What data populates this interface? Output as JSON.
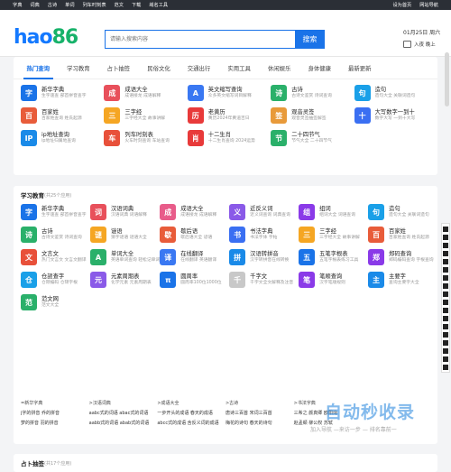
{
  "topbar": {
    "links": [
      "字典",
      "词典",
      "古诗",
      "单词",
      "列车时刻表",
      "范文",
      "下载",
      "域名工具"
    ],
    "right": [
      "设为首页",
      "网站导航"
    ]
  },
  "logo": {
    "a": "hao",
    "b": "86"
  },
  "search": {
    "placeholder": "请输入搜索内容",
    "button": "搜索"
  },
  "date": {
    "text": "01月25日 周六",
    "login": "入夜 晚上"
  },
  "tabs": [
    "热门查询",
    "学习教育",
    "占卜抽签",
    "民俗文化",
    "交通出行",
    "实用工具",
    "休闲娱乐",
    "身体健康",
    "最新更新"
  ],
  "hot": [
    {
      "t": "新华字典",
      "d": "生字速查 部首拼音查字",
      "c": "#1a73e8",
      "i": "字"
    },
    {
      "t": "成语大全",
      "d": "成语接龙 成语解释",
      "c": "#e8505b",
      "i": "成"
    },
    {
      "t": "英文缩写查询",
      "d": "众多英文缩写词目解释",
      "c": "#3a78f2",
      "i": "A"
    },
    {
      "t": "古诗",
      "d": "古诗文鉴赏 诗词查询",
      "c": "#2ab06a",
      "i": "诗"
    },
    {
      "t": "造句",
      "d": "造句大全 关联词造句",
      "c": "#1aa0e8",
      "i": "句"
    },
    {
      "t": "百家姓",
      "d": "百家姓查询 姓氏起源",
      "c": "#e85c3a",
      "i": "百"
    },
    {
      "t": "三字经",
      "d": "三字经大全 故事讲解",
      "c": "#f5a623",
      "i": "三"
    },
    {
      "t": "老黄历",
      "d": "黄历2024年黄道吉日",
      "c": "#e83a3a",
      "i": "历"
    },
    {
      "t": "观音灵签",
      "d": "观音灵签抽签解签",
      "c": "#e89a3a",
      "i": "签"
    },
    {
      "t": "大写数字一到十",
      "d": "数字大写 一到十大写",
      "c": "#3a6ff2",
      "i": "十"
    },
    {
      "t": "ip地址查询",
      "d": "ip地址归属地查询",
      "c": "#1a8ae8",
      "i": "IP"
    },
    {
      "t": "列车时刻表",
      "d": "火车时刻查询 车站查询",
      "c": "#e8503a",
      "i": "车"
    },
    {
      "t": "十二生肖",
      "d": "十二生肖查询 2024运势",
      "c": "#e83a3a",
      "i": "肖"
    },
    {
      "t": "二十四节气",
      "d": "节气大全 二十四节气",
      "c": "#2ab06a",
      "i": "节"
    }
  ],
  "study": {
    "title": "学习教育",
    "count": "(共25个应用)"
  },
  "edu": [
    {
      "t": "新华字典",
      "d": "生字速查 部首拼音查字",
      "c": "#1a73e8",
      "i": "字"
    },
    {
      "t": "汉语词典",
      "d": "汉语词典 词语解释",
      "c": "#e8505b",
      "i": "词"
    },
    {
      "t": "成语大全",
      "d": "成语接龙 成语解释",
      "c": "#e85c8a",
      "i": "成"
    },
    {
      "t": "近反义词",
      "d": "近义词查询 词典查询",
      "c": "#8a5ae8",
      "i": "义"
    },
    {
      "t": "组词",
      "d": "组词大全 词语查询",
      "c": "#8a3ae8",
      "i": "组"
    },
    {
      "t": "造句",
      "d": "造句大全 关联词造句",
      "c": "#1aa0e8",
      "i": "句"
    },
    {
      "t": "古诗",
      "d": "古诗文鉴赏 诗词查询",
      "c": "#2ab06a",
      "i": "诗"
    },
    {
      "t": "谜语",
      "d": "猜字谜语 谜语大全",
      "c": "#f5a623",
      "i": "谜"
    },
    {
      "t": "歇后语",
      "d": "歇后语大全 谚语",
      "c": "#e85c3a",
      "i": "歇"
    },
    {
      "t": "书法字典",
      "d": "书法字体 字帖",
      "c": "#3a6ff2",
      "i": "书"
    },
    {
      "t": "三字经",
      "d": "三字经大全 故事讲解",
      "c": "#f5a623",
      "i": "三"
    },
    {
      "t": "百家姓",
      "d": "百家姓查询 姓氏起源",
      "c": "#e85c3a",
      "i": "百"
    },
    {
      "t": "文言文",
      "d": "热门文言文 文言文翻译",
      "c": "#e8503a",
      "i": "文"
    },
    {
      "t": "单词大全",
      "d": "英语单词查询 轻松记单词",
      "c": "#2ab06a",
      "i": "A"
    },
    {
      "t": "在线翻译",
      "d": "在线翻译 英语翻译",
      "c": "#3a78f2",
      "i": "译"
    },
    {
      "t": "汉语转拼音",
      "d": "汉字转拼音在线转换",
      "c": "#1a8ae8",
      "i": "拼"
    },
    {
      "t": "五笔字根表",
      "d": "五笔字根表练习工具",
      "c": "#1a73e8",
      "i": "五"
    },
    {
      "t": "郑码查询",
      "d": "郑码编码查询 字根查询",
      "c": "#8a3ae8",
      "i": "郑"
    },
    {
      "t": "仓颉查字",
      "d": "仓颉编码 仓颉字根",
      "c": "#1aa0e8",
      "i": "仓"
    },
    {
      "t": "元素周期表",
      "d": "化学元素 元素周期表",
      "c": "#8a5ae8",
      "i": "元"
    },
    {
      "t": "圆周率",
      "d": "圆周率100位1000位",
      "c": "#1a73e8",
      "i": "π"
    },
    {
      "t": "千字文",
      "d": "千字文全文解释及注音",
      "c": "#c8c8c8",
      "i": "千"
    },
    {
      "t": "笔顺查询",
      "d": "汉字笔顺规则",
      "c": "#8a3ae8",
      "i": "笔"
    },
    {
      "t": "主要字",
      "d": "查询主要字大全",
      "c": "#1a8ae8",
      "i": "主"
    },
    {
      "t": "范文网",
      "d": "范文大全",
      "c": "#2ab06a",
      "i": "范"
    }
  ],
  "sub": [
    [
      "=新华字典",
      "j字的拼音 乔的拼音",
      "梦的拼音 羽的拼音"
    ],
    [
      ">汉语词典",
      "aabc式的词语 abac式的词语",
      "aabb式的词语 abab式的词语"
    ],
    [
      ">成语大全",
      "一步开头的成语 春天的成语",
      "abcc式的成语 含反义词的成语"
    ],
    [
      ">古诗",
      "唐诗三百首 宋词三百首",
      "梅花的诗句 春天的诗句"
    ],
    [
      ">书法字典",
      "三希之 颜真卿 欧阳询",
      "赵孟頫 柳公权 苏轼"
    ]
  ],
  "fortune": {
    "title": "占卜抽签",
    "count": "(共17个应用)"
  },
  "watermark": {
    "big": "自动秒收录",
    "small": "加入导航 —来访一步 — 排名靠前一"
  }
}
